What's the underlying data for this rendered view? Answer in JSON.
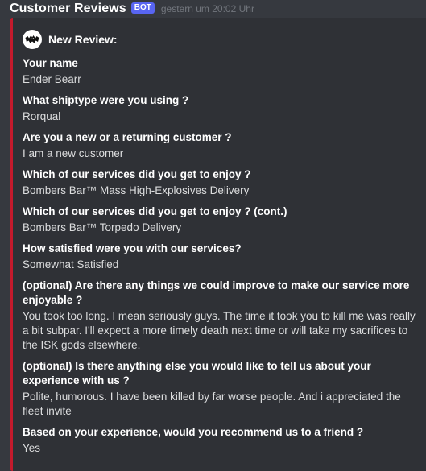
{
  "message": {
    "author": "Customer Reviews",
    "bot_tag": "BOT",
    "timestamp": "gestern um 20:02 Uhr"
  },
  "embed": {
    "accent_color": "#c41a2c",
    "author_icon": "bat-logo-icon",
    "author_name": "New Review:",
    "fields": [
      {
        "name": "Your name",
        "value": "Ender Bearr"
      },
      {
        "name": "What shiptype were you using ?",
        "value": "Rorqual"
      },
      {
        "name": "Are you a new or a returning customer ?",
        "value": "I am a new customer"
      },
      {
        "name": "Which of our services did you get to enjoy ?",
        "value": "Bombers Bar™ Mass High-Explosives Delivery"
      },
      {
        "name": "Which of our services did you get to enjoy ? (cont.)",
        "value": "Bombers Bar™ Torpedo Delivery"
      },
      {
        "name": "How satisfied were you with our services?",
        "value": "Somewhat Satisfied"
      },
      {
        "name": "(optional) Are there any things we could improve to make our service more enjoyable ?",
        "value": "You took too long. I mean seriously guys. The time it took you to kill me was really a bit subpar. I'll expect a more timely death next time or will take my sacrifices to the ISK gods elsewhere."
      },
      {
        "name": "(optional) Is there anything else you would like to tell us about your experience with us ?",
        "value": "Polite, humorous. I have been killed by far worse people. And i appreciated the fleet invite"
      },
      {
        "name": "Based on your experience, would you recommend us to a friend ?",
        "value": "Yes"
      }
    ]
  }
}
